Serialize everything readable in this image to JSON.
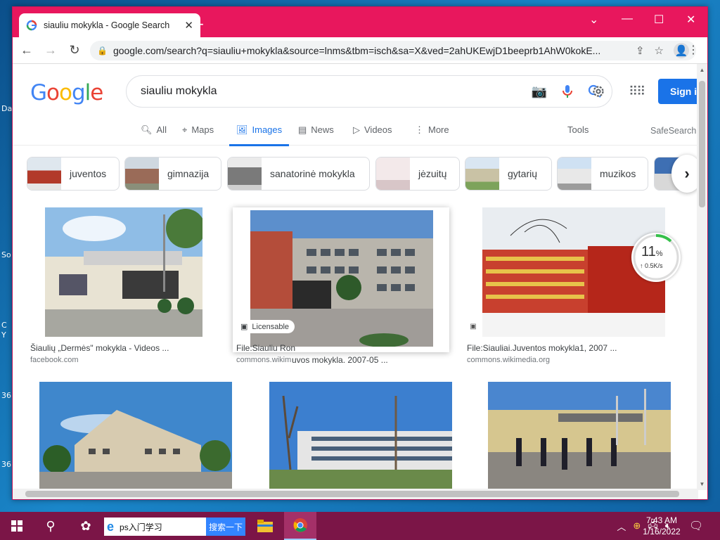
{
  "desktop": {
    "icon_labels": [
      "Da",
      "So",
      "C",
      "Y",
      "36",
      "36"
    ]
  },
  "browser": {
    "tab_title": "siauliu mokykla - Google Search",
    "tab_close": "✕",
    "new_tab": "+",
    "url": "google.com/search?q=siauliu+mokykla&source=lnms&tbm=isch&sa=X&ved=2ahUKEwjD1beeprb1AhW0kokE...",
    "colors": {
      "titlebar": "#e8175d",
      "accent": "#1a73e8"
    }
  },
  "google": {
    "logo": [
      "G",
      "o",
      "o",
      "g",
      "l",
      "e"
    ],
    "logo_colors": [
      "#4285f4",
      "#ea4335",
      "#fbbc05",
      "#4285f4",
      "#34a853",
      "#ea4335"
    ],
    "search_query": "siauliu mokykla",
    "sign_in": "Sign i",
    "tabs": [
      {
        "label": "All",
        "icon": "search-icon"
      },
      {
        "label": "Maps",
        "icon": "map-pin-icon"
      },
      {
        "label": "Images",
        "icon": "image-icon",
        "active": true
      },
      {
        "label": "News",
        "icon": "news-icon"
      },
      {
        "label": "Videos",
        "icon": "video-icon"
      },
      {
        "label": "More",
        "icon": "more-vert-icon"
      }
    ],
    "tools": "Tools",
    "safesearch": "SafeSearch",
    "chips": [
      "juventos",
      "gimnazija",
      "sanatorinė mokykla",
      "jėzuitų",
      "gytarių",
      "muzikos"
    ]
  },
  "results": [
    {
      "title": "Šiaulių „Dermės\" mokykla - Videos ...",
      "source": "facebook.com"
    },
    {
      "title": "File:Siauliu Ron",
      "source": "commons.wikim",
      "badge": "Licensable"
    },
    {
      "title": "File:Siauliai.Juventos mokykla1, 2007 ...",
      "source": "commons.wikimedia.org"
    },
    {
      "title_overlay": "uvos mokykla. 2007-05 ..."
    }
  ],
  "speed_widget": {
    "percent": "11",
    "percent_sign": "%",
    "rate": "↑ 0.5K/s"
  },
  "taskbar": {
    "search_text": "ps入门学习",
    "search_button": "搜索一下",
    "time": "7:43 AM",
    "date": "1/16/2022"
  }
}
